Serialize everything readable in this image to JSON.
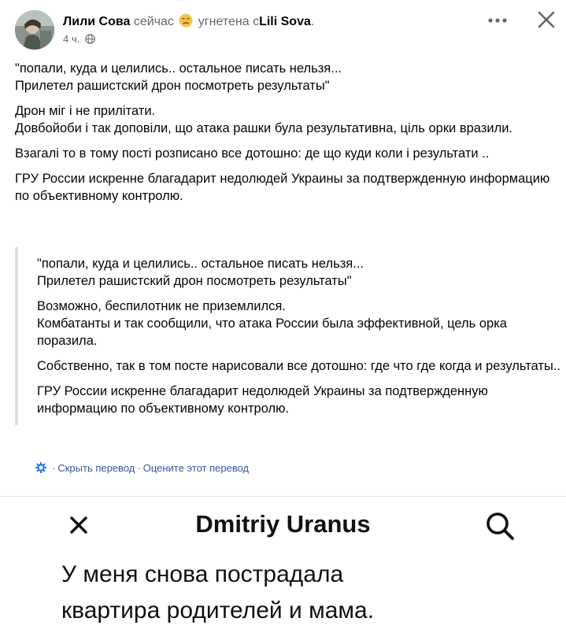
{
  "post": {
    "author": "Лили Сова",
    "time_label": "сейчас",
    "feeling": "угнетена",
    "with_word": "с",
    "tagged_user": "Lili Sova",
    "tagged_suffix": ".",
    "timestamp": "4 ч.",
    "icons": {
      "feeling": "sad-face-emoji",
      "privacy": "globe-icon",
      "more": "more-options-icon",
      "close": "close-icon"
    },
    "body": [
      "\"попали, куда и целились.. остальное писать нельзя...\nПрилетел рашистский дрон посмотреть результаты\"",
      "Дрон міг і не прилітати.\n Довбойоби і так доповіли, що атака рашки була результативна, ціль орки вразили.",
      "Взагалі то в тому пості розписано все дотошно: де що куди коли і результати ..",
      "ГРУ России искренне благадарит недолюдей Украины за подтвержденную информацию по объективному контролю."
    ]
  },
  "translation": {
    "paragraphs": [
      "\"попали, куда и целились.. остальное писать нельзя...\nПрилетел рашистский дрон посмотреть результаты\"",
      "Возможно, беспилотник не приземлился.\nКомбатанты и так сообщили, что атака России была эффективной, цель орка поразила.",
      "Собственно, так в том посте нарисовали все дотошно: где что где когда и результаты..",
      "ГРУ России искренне благадарит недолюдей Украины за подтвержденную информацию по объективному контролю."
    ],
    "hide_label": "Скрыть перевод",
    "separator": "·",
    "rate_label": "Оцените этот перевод",
    "icon": "gear-icon"
  },
  "attached_screenshot": {
    "title": "Dmitriy Uranus",
    "line1": "У меня снова пострадала",
    "line2": "квартира родителей и мама.",
    "icons": {
      "close": "close-icon",
      "search": "search-icon"
    }
  },
  "colors": {
    "link": "#385898",
    "secondary_text": "#65676b",
    "quote_bar": "#dcdfe3"
  }
}
